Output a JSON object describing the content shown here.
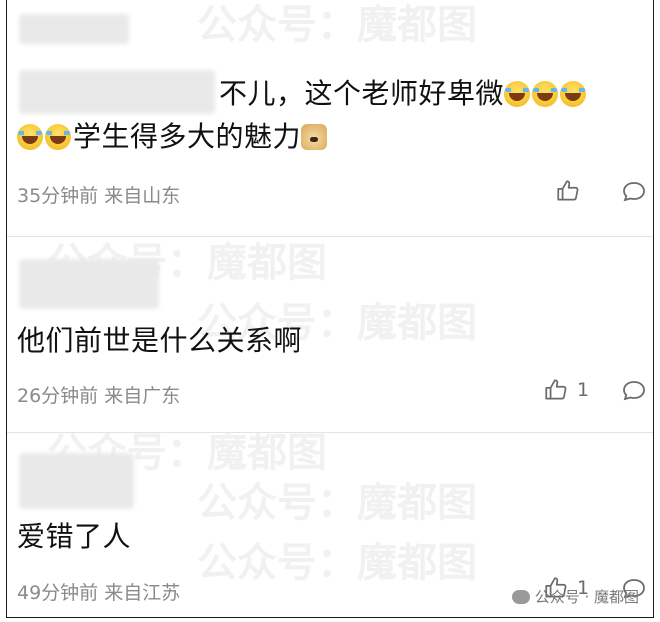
{
  "comments": [
    {
      "text_main": "不儿，这个老师好卑微",
      "text_second": "学生得多大的魅力",
      "time": "35分钟前",
      "location": "来自山东",
      "likes": ""
    },
    {
      "text_main": "他们前世是什么关系啊",
      "time": "26分钟前",
      "location": "来自广东",
      "likes": "1"
    },
    {
      "text_main": "爱错了人",
      "time": "49分钟前",
      "location": "来自江苏",
      "likes": "1"
    }
  ],
  "watermark": "公众号：魔都图",
  "brand": {
    "label": "公众号 · 魔都图"
  },
  "icons": {
    "like": "thumbs-up-icon",
    "reply": "comment-bubble-icon",
    "laugh_cry": "laugh-cry-emoji",
    "doge": "doge-emoji"
  },
  "colors": {
    "text": "#111111",
    "meta": "#8a8a8a",
    "icon": "#6b6b6b",
    "divider": "#e4e4e4"
  }
}
